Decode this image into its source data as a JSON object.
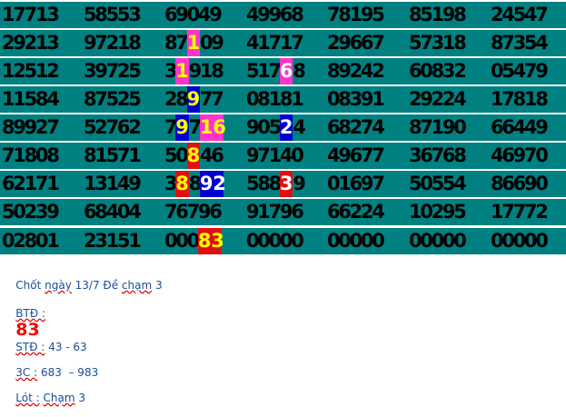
{
  "grid": {
    "rows": [
      [
        "17713",
        "58553",
        "69049",
        "49968",
        "78195",
        "85198",
        "24547"
      ],
      [
        "29213",
        "97218",
        "87109",
        "41717",
        "29667",
        "57318",
        "87354"
      ],
      [
        "12512",
        "39725",
        "31918",
        "51768",
        "89242",
        "60832",
        "05479"
      ],
      [
        "11584",
        "87525",
        "28977",
        "08181",
        "08391",
        "29224",
        "17818"
      ],
      [
        "89927",
        "52762",
        "79716",
        "90524",
        "68274",
        "87190",
        "66449"
      ],
      [
        "71808",
        "81571",
        "50846",
        "97140",
        "49677",
        "36768",
        "46970"
      ],
      [
        "62171",
        "13149",
        "38892",
        "58839",
        "01697",
        "50554",
        "86690"
      ],
      [
        "50239",
        "68404",
        "76796",
        "91796",
        "66224",
        "10295",
        "17772"
      ],
      [
        "02801",
        "23151",
        "00083",
        "00000",
        "00000",
        "00000",
        "00000"
      ]
    ]
  },
  "highlights": [
    {
      "row": 1,
      "col": 2,
      "pos": 2,
      "digits": "1",
      "bg": "#ff33cc",
      "fg": "#ffff00"
    },
    {
      "row": 2,
      "col": 2,
      "pos": 1,
      "digits": "1",
      "bg": "#ff33cc",
      "fg": "#ffff00"
    },
    {
      "row": 2,
      "col": 3,
      "pos": 3,
      "digits": "6",
      "bg": "#ff33cc",
      "fg": "#ffffff"
    },
    {
      "row": 3,
      "col": 2,
      "pos": 2,
      "digits": "9",
      "bg": "#0000cc",
      "fg": "#ffff00"
    },
    {
      "row": 4,
      "col": 2,
      "pos": 1,
      "digits": "9",
      "bg": "#0000cc",
      "fg": "#ffff00"
    },
    {
      "row": 4,
      "col": 2,
      "pos": 3,
      "digits": "16",
      "bg": "#ff33cc",
      "fg": "#ffff00"
    },
    {
      "row": 4,
      "col": 3,
      "pos": 3,
      "digits": "2",
      "bg": "#0000cc",
      "fg": "#ffffff"
    },
    {
      "row": 5,
      "col": 2,
      "pos": 2,
      "digits": "8",
      "bg": "#e01010",
      "fg": "#ffff00"
    },
    {
      "row": 6,
      "col": 2,
      "pos": 1,
      "digits": "8",
      "bg": "#e01010",
      "fg": "#ffff00"
    },
    {
      "row": 6,
      "col": 2,
      "pos": 3,
      "digits": "92",
      "bg": "#0000cc",
      "fg": "#ffffff"
    },
    {
      "row": 6,
      "col": 3,
      "pos": 3,
      "digits": "3",
      "bg": "#e01010",
      "fg": "#ffffff"
    },
    {
      "row": 8,
      "col": 2,
      "pos": 3,
      "digits": "83",
      "bg": "#e01010",
      "fg": "#ffff00"
    }
  ],
  "notes": {
    "line1_prefix": "Chốt ",
    "line1_ngay": "ngày",
    "line1_rest": " 13/7 ",
    "line1_de": "Đề",
    "line1_cham": "chạm",
    "line1_tail": " 3",
    "btd_label": "BTĐ :",
    "btd_value": "83",
    "std_label": "STĐ :",
    "std_value": " 43 - 63",
    "c3_label": "3C :",
    "c3_value": " 683  – 983",
    "lot_label": "Lót :",
    "lot_cham": "Chạm",
    "lot_value": " 3"
  },
  "colors": {
    "grid_bg": "#008080",
    "note_text": "#1a4e9a",
    "btd_value": "#ff0000"
  }
}
